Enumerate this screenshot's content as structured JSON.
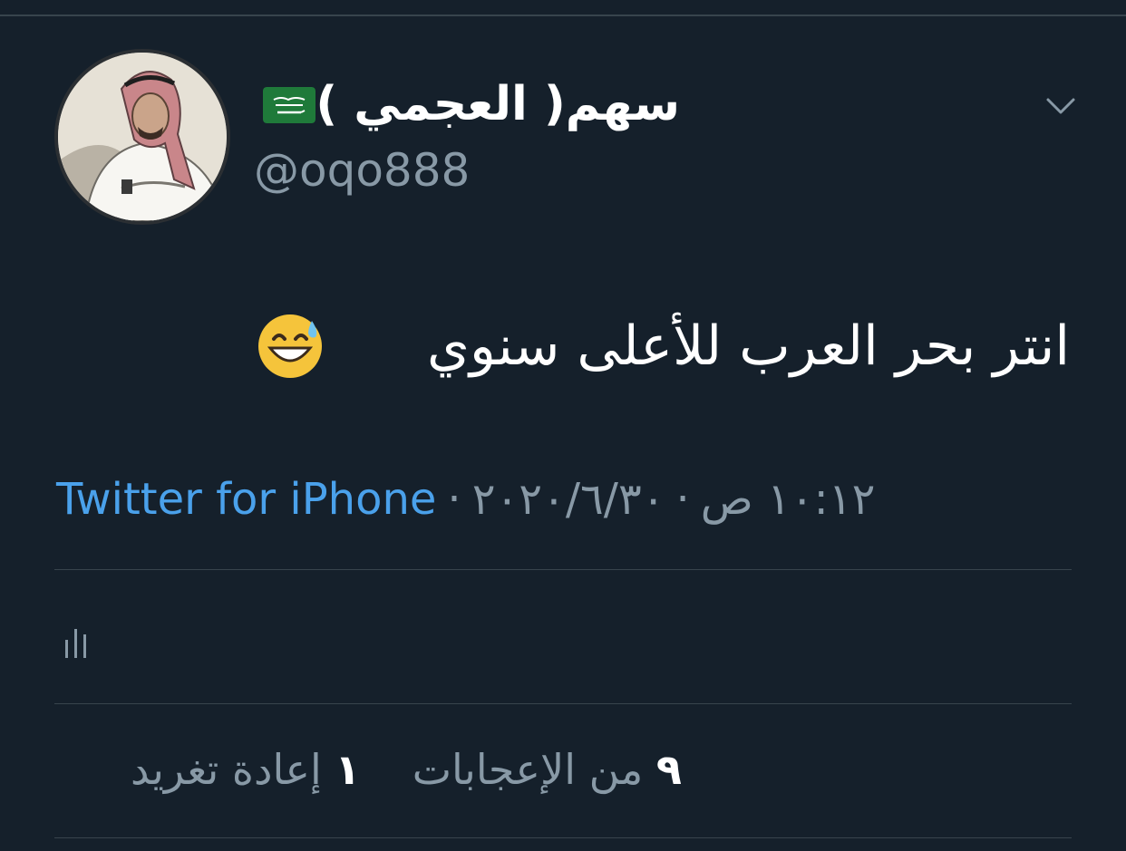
{
  "tweet": {
    "author": {
      "display_name": "سهم( العجمي )",
      "handle": "@oqo888",
      "flag_icon": "saudi-flag-icon"
    },
    "text": "انتر بحر العرب للأعلى سنوي",
    "emoji_icon": "grinning-face-with-sweat-icon",
    "time": "١٠:١٢ ص",
    "date": "٢٠٢٠/٦/٣٠",
    "separator": "·",
    "source": "Twitter for iPhone",
    "stats": {
      "likes_count": "٩",
      "likes_label": "من الإعجابات",
      "retweets_count": "١",
      "retweets_label": "إعادة تغريد"
    },
    "colors": {
      "background": "#15202b",
      "link": "#4aa1eb",
      "muted": "#8899a6",
      "divider": "#38444d"
    },
    "icons": {
      "menu": "chevron-down-icon",
      "analytics": "analytics-icon"
    }
  }
}
